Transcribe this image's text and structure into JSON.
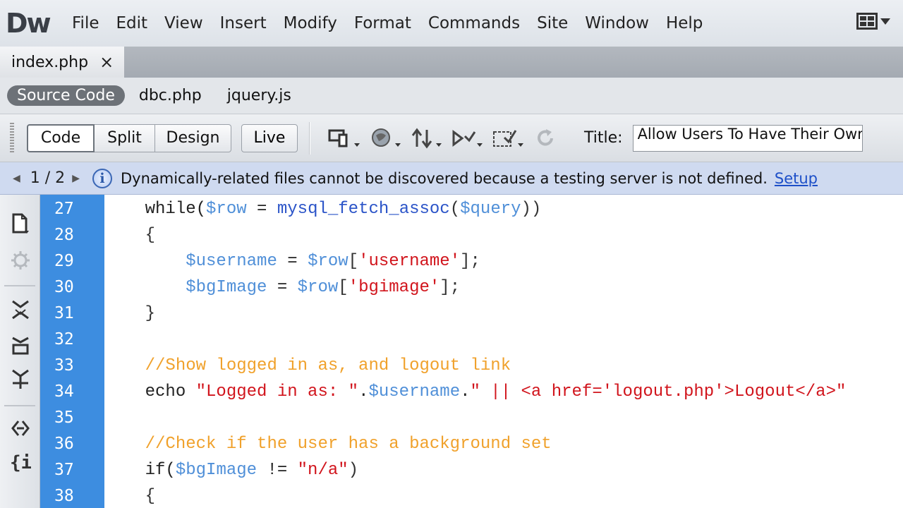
{
  "app": {
    "logo": "Dw",
    "menu": [
      "File",
      "Edit",
      "View",
      "Insert",
      "Modify",
      "Format",
      "Commands",
      "Site",
      "Window",
      "Help"
    ]
  },
  "document_tab": {
    "name": "index.php",
    "close": "×"
  },
  "related_files": {
    "items": [
      "Source Code",
      "dbc.php",
      "jquery.js"
    ],
    "active": "Source Code"
  },
  "doc_toolbar": {
    "views": [
      "Code",
      "Split",
      "Design"
    ],
    "selected_view": "Code",
    "live_label": "Live",
    "title_label": "Title:",
    "title_value": "Allow Users To Have Their Own"
  },
  "info_bar": {
    "page": "1 / 2",
    "message": "Dynamically-related files cannot be discovered because a testing server is not defined.",
    "link": "Setup"
  },
  "editor": {
    "line_numbers": [
      "27",
      "28",
      "29",
      "30",
      "31",
      "32",
      "33",
      "34",
      "35",
      "36",
      "37",
      "38"
    ],
    "lines": [
      [
        {
          "t": "kw",
          "v": "    while("
        },
        {
          "t": "var",
          "v": "$row"
        },
        {
          "t": "kw",
          "v": " = "
        },
        {
          "t": "fn",
          "v": "mysql_fetch_assoc"
        },
        {
          "t": "pn",
          "v": "("
        },
        {
          "t": "var",
          "v": "$query"
        },
        {
          "t": "pn",
          "v": "))"
        }
      ],
      [
        {
          "t": "pn",
          "v": "    {"
        }
      ],
      [
        {
          "t": "var",
          "v": "        $username"
        },
        {
          "t": "kw",
          "v": " = "
        },
        {
          "t": "var",
          "v": "$row"
        },
        {
          "t": "pn",
          "v": "["
        },
        {
          "t": "str",
          "v": "'username'"
        },
        {
          "t": "pn",
          "v": "];"
        }
      ],
      [
        {
          "t": "var",
          "v": "        $bgImage"
        },
        {
          "t": "kw",
          "v": " = "
        },
        {
          "t": "var",
          "v": "$row"
        },
        {
          "t": "pn",
          "v": "["
        },
        {
          "t": "str",
          "v": "'bgimage'"
        },
        {
          "t": "pn",
          "v": "];"
        }
      ],
      [
        {
          "t": "pn",
          "v": "    }"
        }
      ],
      [],
      [
        {
          "t": "cm",
          "v": "    //Show logged in as, and logout link"
        }
      ],
      [
        {
          "t": "kw",
          "v": "    echo "
        },
        {
          "t": "str",
          "v": "\"Logged in as: \""
        },
        {
          "t": "kw",
          "v": "."
        },
        {
          "t": "var",
          "v": "$username"
        },
        {
          "t": "kw",
          "v": "."
        },
        {
          "t": "str",
          "v": "\" || <a href='logout.php'>Logout</a>\""
        }
      ],
      [],
      [
        {
          "t": "cm",
          "v": "    //Check if the user has a background set"
        }
      ],
      [
        {
          "t": "kw",
          "v": "    if("
        },
        {
          "t": "var",
          "v": "$bgImage"
        },
        {
          "t": "kw",
          "v": " != "
        },
        {
          "t": "str",
          "v": "\"n/a\""
        },
        {
          "t": "pn",
          "v": ")"
        }
      ],
      [
        {
          "t": "pn",
          "v": "    {"
        }
      ]
    ]
  },
  "icons": {
    "workspace": "workspace-switcher-icon",
    "toolbar": [
      "multiscreen-icon",
      "preview-in-browser-icon",
      "file-management-icon",
      "w3c-validation-icon",
      "visual-aids-icon",
      "refresh-icon"
    ],
    "coding": [
      "open-documents-icon",
      "show-code-navigator-icon",
      "collapse-full-tag-icon",
      "collapse-selection-icon",
      "expand-all-icon",
      "select-parent-tag-icon",
      "balance-braces-icon"
    ]
  }
}
